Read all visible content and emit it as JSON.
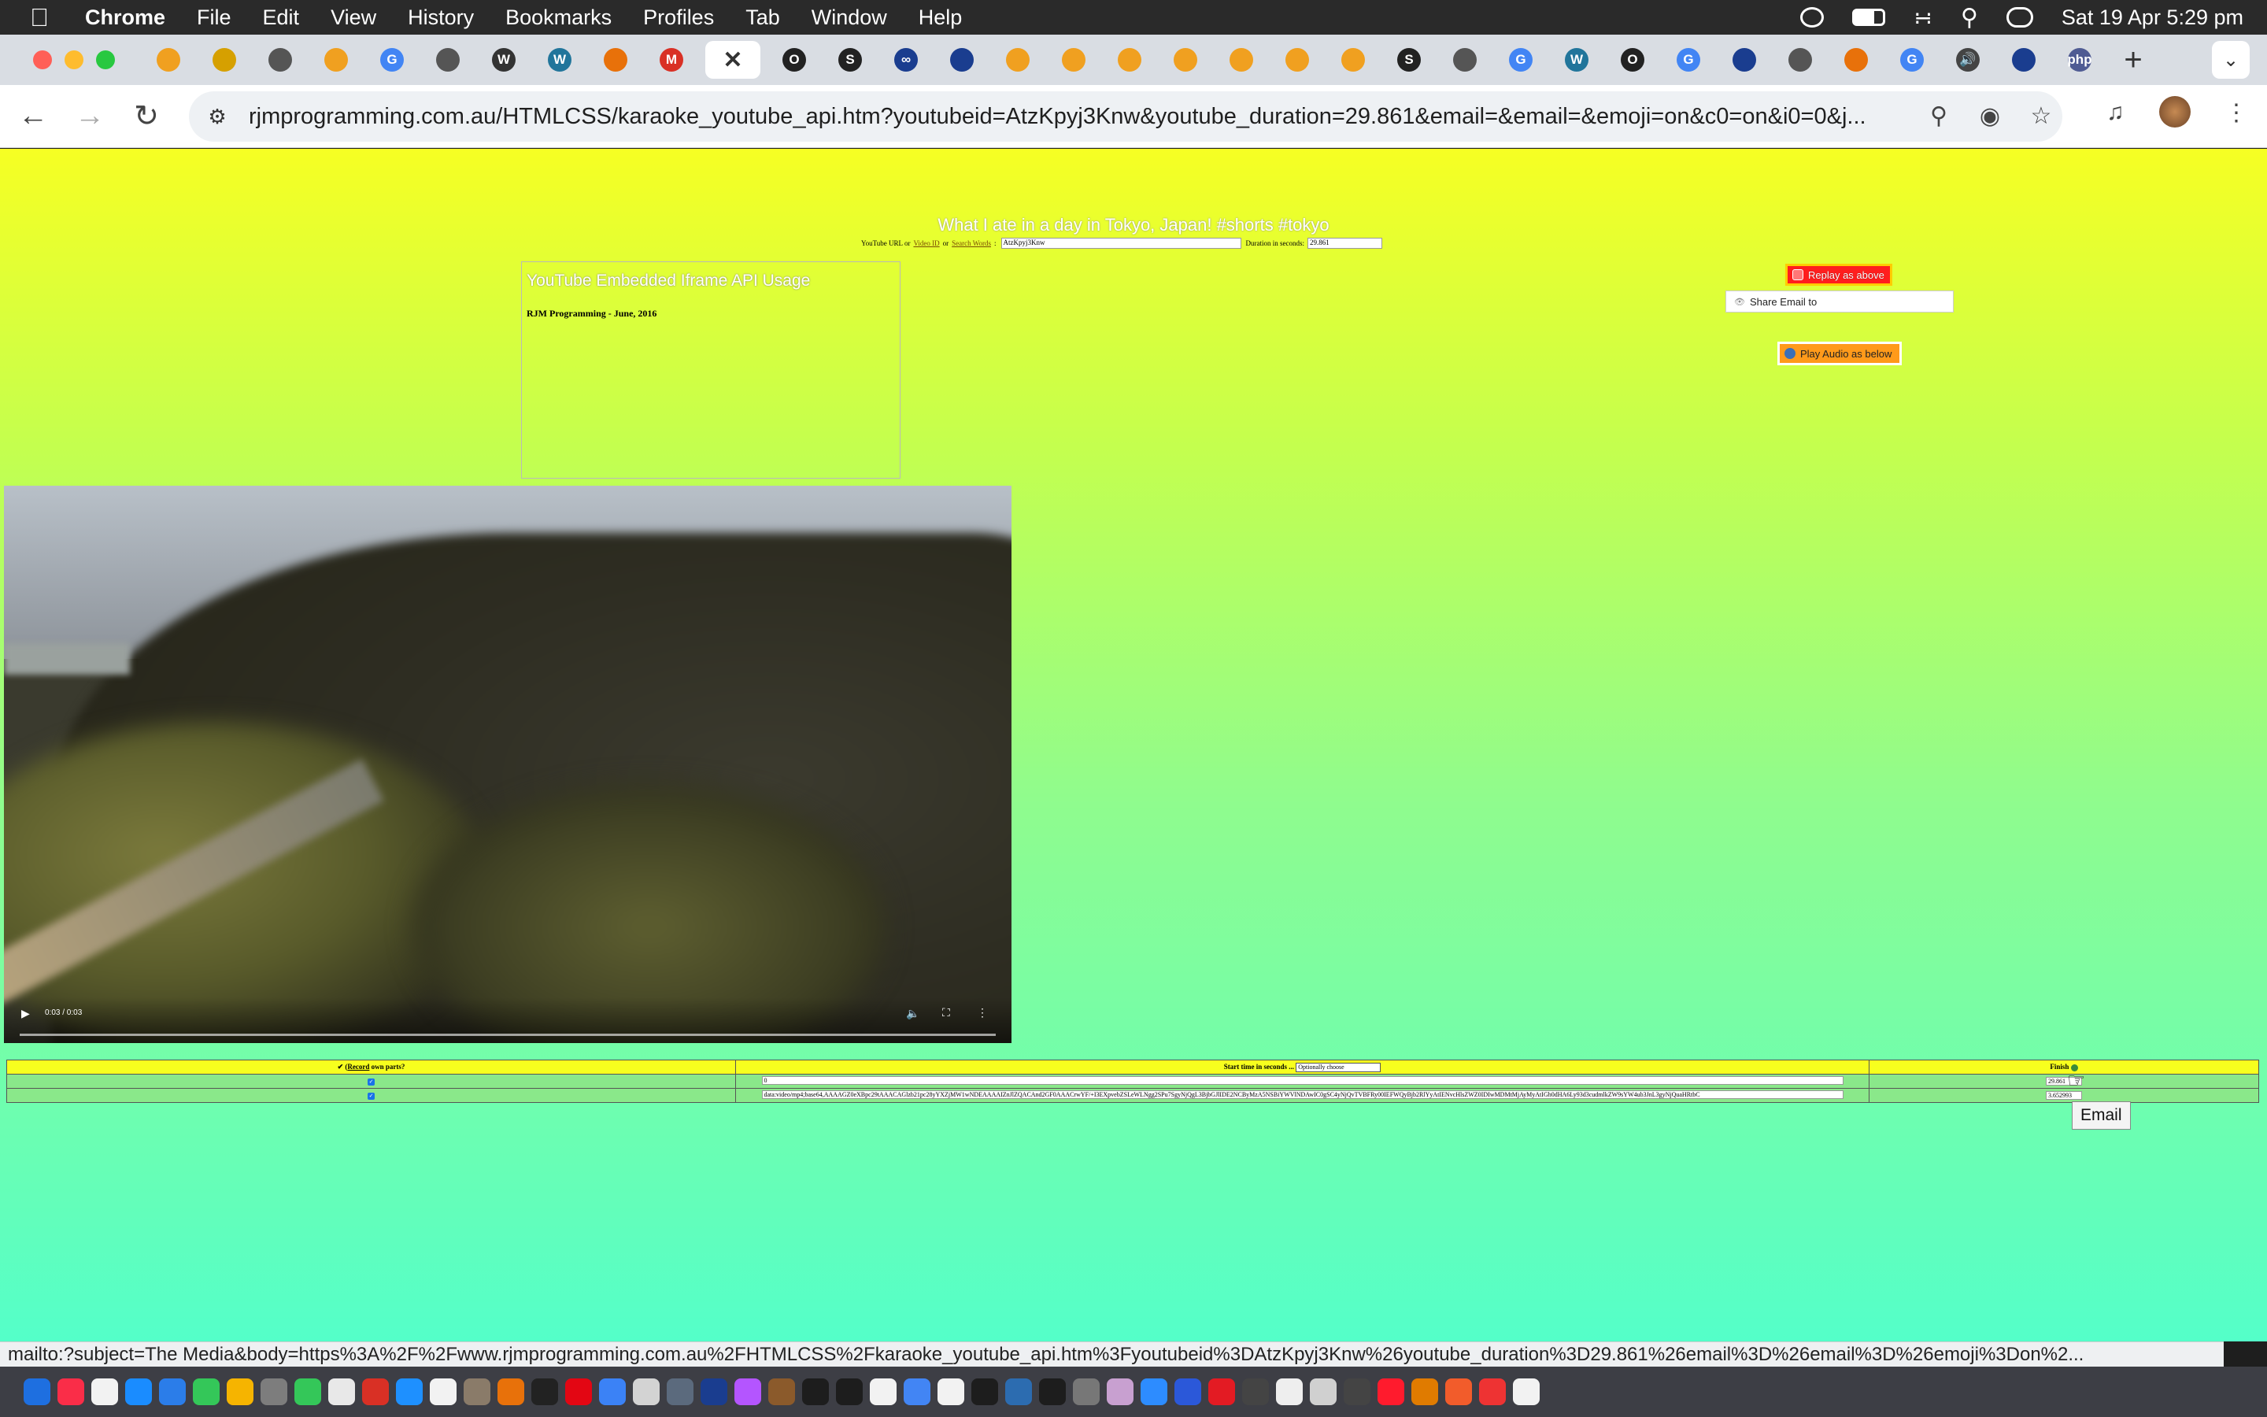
{
  "menubar": {
    "app": "Chrome",
    "items": [
      "File",
      "Edit",
      "View",
      "History",
      "Bookmarks",
      "Profiles",
      "Tab",
      "Window",
      "Help"
    ],
    "clock": "Sat 19 Apr  5:29 pm"
  },
  "tabs": [
    {
      "icon": "pen-icon",
      "color": "#f0a020",
      "label": ""
    },
    {
      "icon": "check-icon",
      "color": "#d6a000",
      "label": ""
    },
    {
      "icon": "chrome-icon",
      "color": "#555555",
      "label": ""
    },
    {
      "icon": "pen-icon",
      "color": "#f0a020",
      "label": ""
    },
    {
      "icon": "google-icon",
      "color": "#4285f4",
      "label": "G"
    },
    {
      "icon": "chrome-icon",
      "color": "#555555",
      "label": ""
    },
    {
      "icon": "wikipedia-icon",
      "color": "#333333",
      "label": "W"
    },
    {
      "icon": "wordpress-icon",
      "color": "#21759b",
      "label": "W"
    },
    {
      "icon": "dots-icon",
      "color": "#e8710a",
      "label": ""
    },
    {
      "icon": "gmail-icon",
      "color": "#d93025",
      "label": "M"
    },
    {
      "icon": "close-icon",
      "color": "",
      "label": "✕",
      "active": true
    },
    {
      "icon": "o-icon",
      "color": "#222222",
      "label": "O"
    },
    {
      "icon": "s-icon",
      "color": "#222222",
      "label": "S"
    },
    {
      "icon": "abc-icon",
      "color": "#1a3d8f",
      "label": "∞"
    },
    {
      "icon": "afl-icon",
      "color": "#1a3d8f",
      "label": ""
    },
    {
      "icon": "pen-icon",
      "color": "#f0a020",
      "label": ""
    },
    {
      "icon": "pen-icon",
      "color": "#f0a020",
      "label": ""
    },
    {
      "icon": "pen-icon",
      "color": "#f0a020",
      "label": ""
    },
    {
      "icon": "pen-icon",
      "color": "#f0a020",
      "label": ""
    },
    {
      "icon": "pen-icon",
      "color": "#f0a020",
      "label": ""
    },
    {
      "icon": "pen-icon",
      "color": "#f0a020",
      "label": ""
    },
    {
      "icon": "pen-icon",
      "color": "#f0a020",
      "label": ""
    },
    {
      "icon": "s-icon",
      "color": "#222222",
      "label": "S"
    },
    {
      "icon": "chrome-icon",
      "color": "#555555",
      "label": ""
    },
    {
      "icon": "google-icon",
      "color": "#4285f4",
      "label": "G"
    },
    {
      "icon": "wordpress-icon",
      "color": "#21759b",
      "label": "W"
    },
    {
      "icon": "o-icon",
      "color": "#222222",
      "label": "O"
    },
    {
      "icon": "google-icon",
      "color": "#4285f4",
      "label": "G"
    },
    {
      "icon": "afl-icon",
      "color": "#1a3d8f",
      "label": ""
    },
    {
      "icon": "chrome-icon",
      "color": "#555555",
      "label": ""
    },
    {
      "icon": "swirl-icon",
      "color": "#e8710a",
      "label": ""
    },
    {
      "icon": "google-icon",
      "color": "#4285f4",
      "label": "G"
    },
    {
      "icon": "speaker-icon",
      "color": "#444444",
      "label": "🔊"
    },
    {
      "icon": "afl-icon",
      "color": "#1a3d8f",
      "label": ""
    },
    {
      "icon": "php-icon",
      "color": "#4f5b93",
      "label": "php"
    }
  ],
  "toolbar": {
    "url": "rjmprogramming.com.au/HTMLCSS/karaoke_youtube_api.htm?youtubeid=AtzKpyj3Knw&youtube_duration=29.861&email=&email=&emoji=on&c0=on&i0=0&j..."
  },
  "page": {
    "title": "What I ate in a day in Tokyo, Japan! #shorts #tokyo",
    "search": {
      "prefix": "YouTube URL or",
      "video_id_link": "Video ID",
      "or": "or",
      "search_words_link": "Search Words",
      "colon": ":",
      "youtube_value": "AtzKpyj3Knw",
      "duration_label": "Duration in seconds:",
      "duration_value": "29.861"
    },
    "api_heading": "YouTube Embedded Iframe API Usage",
    "api_sub": "RJM Programming - June, 2016",
    "replay_label": "Replay as above",
    "share_label": "Share Email to",
    "play_audio_label": "Play Audio as below",
    "video_time": "0:03 / 0:03"
  },
  "table": {
    "header": {
      "record_prefix": "✔ (",
      "record_link": "Record",
      "record_suffix": " own parts?",
      "start_label": "Start time in seconds ...",
      "start_select": "Optionally choose",
      "finish_label": "Finish"
    },
    "rows": [
      {
        "start": "0",
        "finish": "29.861"
      },
      {
        "start": "data:video/mp4;base64,AAAAGZ0eXBpc29tAAACAGlzb21pc28yYXZjMW1wNDEAAAAIZnJlZQACAnd2GF0AAACrwYF/+I3EXpvebZSLeWLNgg2SPu7SgyNjQgL3BjbGJlIDE2NCByMzA5NSBiYWVlNDAwIC0gSC4yNjQvTVBFRy00IEFWQyBjb2RlYyAtIENvcHlsZWZ0IDIwMDMtMjAyMyAtIGh0dHA6Ly93d3cudmlkZW9sYW4ub3JnL3gyNjQuaHRtbC",
        "finish": "3.652993"
      }
    ]
  },
  "tooltip": "Email",
  "status_url": "mailto:?subject=The Media&body=https%3A%2F%2Fwww.rjmprogramming.com.au%2FHTMLCSS%2Fkaraoke_youtube_api.htm%3Fyoutubeid%3DAtzKpyj3Knw%26youtube_duration%3D29.861%26email%3D%26email%3D%26emoji%3Don%2...",
  "dock": [
    "#1e6fe0",
    "#fa2d48",
    "#f2f2f2",
    "#1a8cff",
    "#2b7de9",
    "#34c759",
    "#f6b400",
    "#7d7d7d",
    "#34c759",
    "#e8e8e8",
    "#d93025",
    "#1e90ff",
    "#f2f2f2",
    "#8a7b69",
    "#e8710a",
    "#222222",
    "#e30613",
    "#3b82f6",
    "#d3d3d3",
    "#5b6a7d",
    "#1a3d8f",
    "#b455ff",
    "#8b5a2b",
    "#1d1d1d",
    "#1d1d1d",
    "#f2f2f2",
    "#4285f4",
    "#f2f2f2",
    "#1d1d1d",
    "#2c6cb0",
    "#1d1d1d",
    "#777777",
    "#c8a0d0",
    "#2d8cff",
    "#2b58d9",
    "#e31b23",
    "#444444",
    "#eeeeee",
    "#d0d0d0",
    "#444444",
    "#ff1b2d",
    "#e07b00",
    "#f25c2b",
    "#e33",
    "#f2f2f2"
  ]
}
